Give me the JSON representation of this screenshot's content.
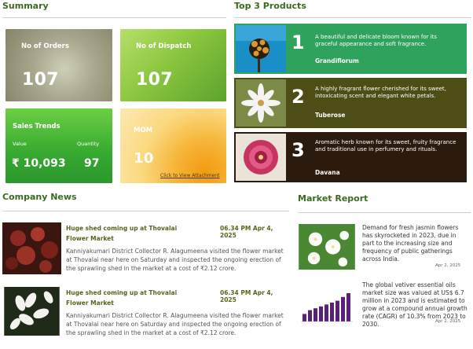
{
  "summary": {
    "title": "Summary",
    "orders": {
      "label": "No of Orders",
      "value": "107"
    },
    "dispatch": {
      "label": "No of Dispatch",
      "value": "107"
    },
    "sales": {
      "label": "Sales Trends",
      "value_label": "Value",
      "quantity_label": "Quantity",
      "value": "₹ 10,093",
      "quantity": "97"
    },
    "mom": {
      "label": "MOM",
      "value": "10",
      "link": "Click to View Attachment"
    }
  },
  "top_products": {
    "title": "Top 3 Products",
    "items": [
      {
        "rank": "1",
        "desc": "A beautiful and delicate bloom known for its graceful appearance and soft fragrance.",
        "name": "Grandiflorum",
        "bg": "#2fa25d"
      },
      {
        "rank": "2",
        "desc": "A highly fragrant flower cherished for its sweet, intoxicating scent and elegant white petals.",
        "name": "Tuberose",
        "bg": "#4d4d16"
      },
      {
        "rank": "3",
        "desc": "Aromatic herb known for its sweet, fruity fragrance and traditional use in perfumery and rituals.",
        "name": "Davana",
        "bg": "#2c1a0d"
      }
    ]
  },
  "news": {
    "title": "Company News",
    "items": [
      {
        "headline": "Huge shed coming up at Thovalai Flower Market",
        "time": "06.34 PM Apr 4, 2025",
        "body": "Kanniyakumari District Collector R. Alagumeena visited the flower market at Thovalai near here on Saturday and inspected the ongoing erection of the sprawling shed in the market at a cost of ₹2.12 crore."
      },
      {
        "headline": "Huge shed coming up at Thovalai Flower Market",
        "time": "06.34 PM Apr 4, 2025",
        "body": "Kanniyakumari District Collector R. Alagumeena visited the flower market at Thovalai near here on Saturday and inspected the ongoing erection of the sprawling shed in the market at a cost of ₹2.12 crore."
      }
    ]
  },
  "market": {
    "title": "Market Report",
    "items": [
      {
        "text": "Demand for fresh jasmin flowers has skyrocketed in 2023, due in part to the increasing size and frequency of public gatherings across India.",
        "date": "Apr 2, 2025"
      },
      {
        "text": "The global vetiver essential oils market size was valued at US$ 6.7 million in 2023 and is estimated to grow at a compound annual growth rate (CAGR) of 10.3% from 2023 to 2030.",
        "date": "Apr 2, 2025"
      }
    ]
  },
  "chart_data": {
    "type": "bar",
    "values": [
      2,
      3,
      3.5,
      4,
      4.5,
      5,
      5.5,
      6.5,
      7.5
    ],
    "title": "",
    "xlabel": "",
    "ylabel": ""
  },
  "colors": {
    "accent": "#3c6b1f",
    "news_headline": "#55651c",
    "chart_bar": "#5a1f78"
  }
}
